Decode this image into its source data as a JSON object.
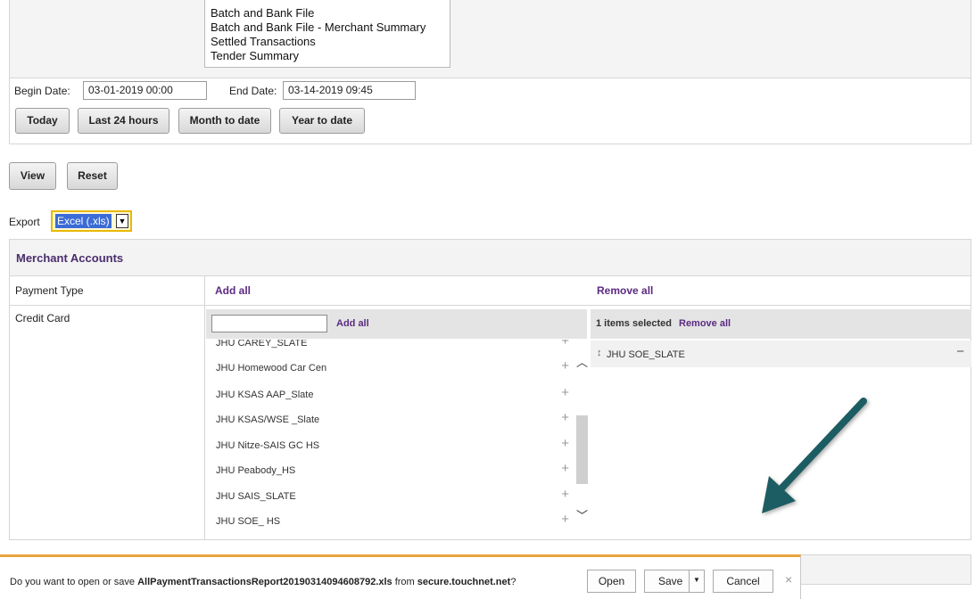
{
  "report_list": {
    "items": [
      "Batch and Bank File",
      "Batch and Bank File - Merchant Summary",
      "Settled Transactions",
      "Tender Summary"
    ]
  },
  "dates": {
    "begin_label": "Begin Date:",
    "begin_value": "03-01-2019 00:00",
    "end_label": "End Date:",
    "end_value": "03-14-2019 09:45"
  },
  "range_buttons": {
    "today": "Today",
    "last24": "Last 24 hours",
    "month": "Month to date",
    "year": "Year to date"
  },
  "actions": {
    "view": "View",
    "reset": "Reset"
  },
  "export": {
    "label": "Export",
    "selected": "Excel (.xls)"
  },
  "merchant": {
    "title": "Merchant Accounts",
    "col_payment_type": "Payment Type",
    "add_all": "Add all",
    "remove_all": "Remove all",
    "row_label": "Credit Card",
    "search_add_all": "Add all",
    "selected_count": "1 items selected",
    "selected_remove_all": "Remove all",
    "available": [
      "JHU CAREY_SLATE",
      "JHU Homewood Car Cen",
      "JHU KSAS AAP_Slate",
      "JHU KSAS/WSE _Slate",
      "JHU Nitze-SAIS GC HS",
      "JHU Peabody_HS",
      "JHU SAIS_SLATE",
      "JHU SOE_ HS"
    ],
    "selected": [
      "JHU SOE_SLATE"
    ]
  },
  "download_bar": {
    "prefix": "Do you want to open or save ",
    "filename": "AllPaymentTransactionsReport20190314094608792.xls",
    "middle": " from ",
    "site": "secure.touchnet.net",
    "suffix": "?",
    "open": "Open",
    "save": "Save",
    "cancel": "Cancel"
  },
  "colors": {
    "purple": "#5b2a82",
    "arrow": "#1f5d63",
    "notify_border": "#e8a33d"
  }
}
